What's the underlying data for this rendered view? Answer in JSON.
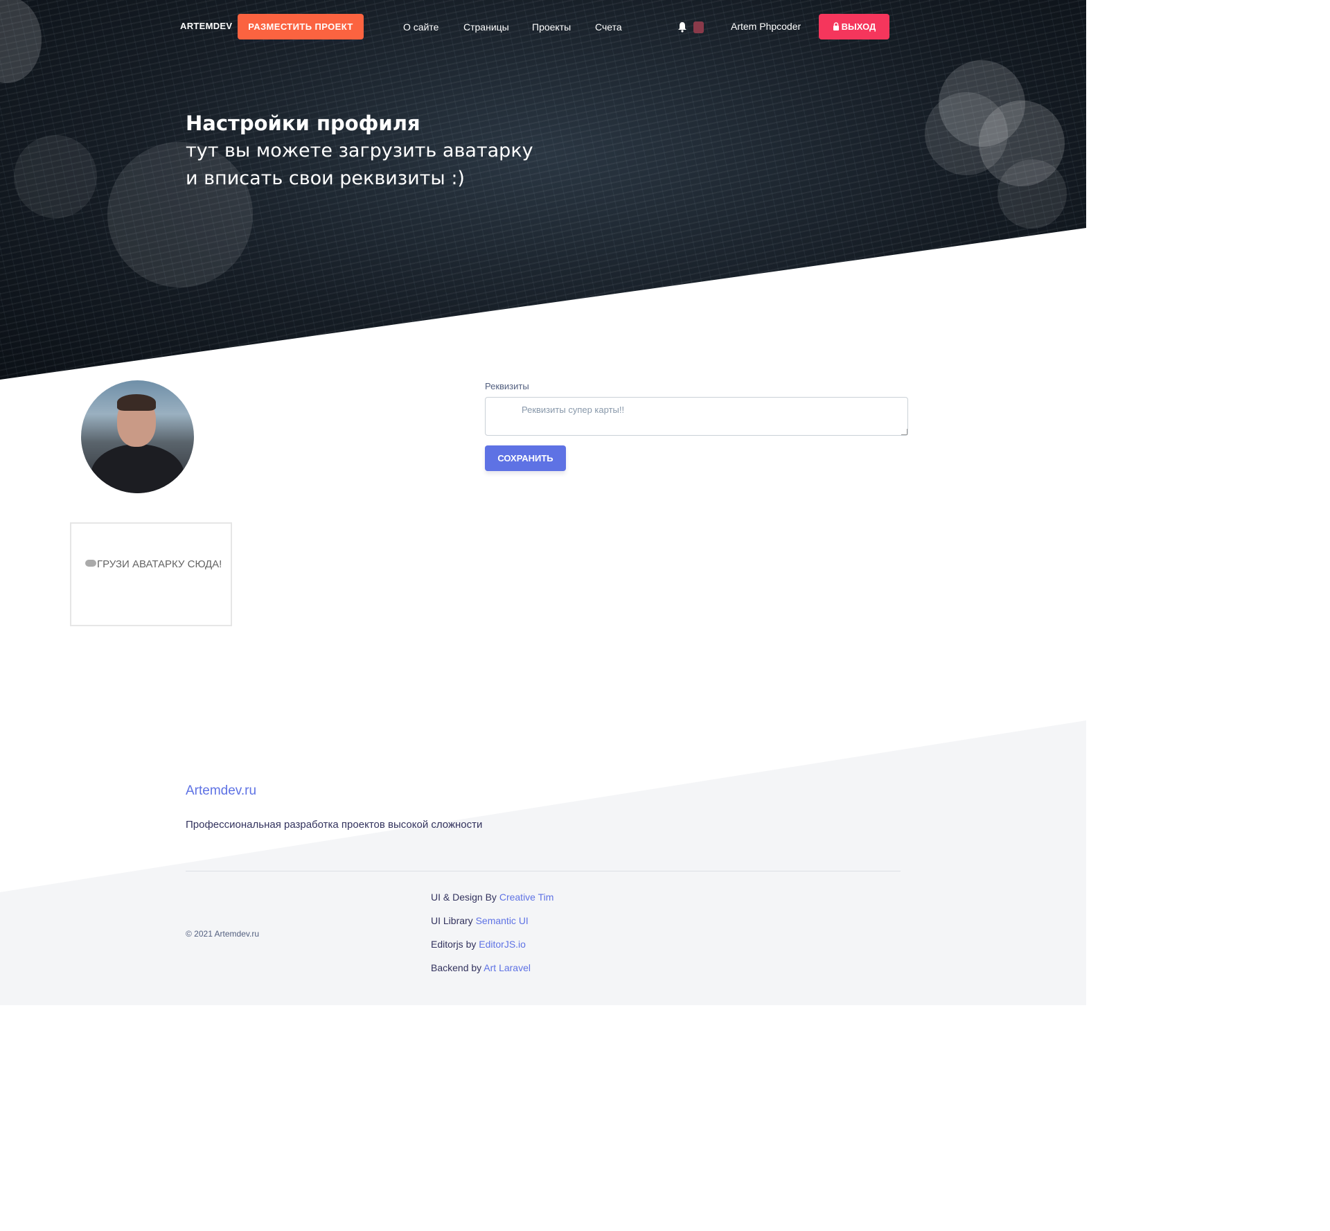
{
  "navbar": {
    "brand": "ARTEMDEV",
    "post_project_label": "РАЗМЕСТИТЬ ПРОЕКТ",
    "links": [
      "О сайте",
      "Страницы",
      "Проекты",
      "Счета"
    ],
    "username": "Artem Phpcoder",
    "logout_label": "ВЫХОД"
  },
  "hero": {
    "title": "Настройки профиля",
    "subtitle_line1": "тут вы можете загрузить аватарку",
    "subtitle_line2": "и вписать свои реквизиты :)"
  },
  "profile": {
    "dropzone_text": "ГРУЗИ АВАТАРКУ СЮДА!",
    "requisites_label": "Реквизиты",
    "requisites_value": "Реквизиты супер карты!!",
    "save_label": "СОХРАНИТЬ"
  },
  "footer": {
    "brand": "Artemdev.ru",
    "tagline": "Профессиональная разработка проектов высокой сложности",
    "copyright": "© 2021 Artemdev.ru",
    "credits": [
      {
        "prefix": "UI & Design By",
        "link": "Creative Tim"
      },
      {
        "prefix": "UI Library",
        "link": "Semantic UI"
      },
      {
        "prefix": "Editorjs by",
        "link": "EditorJS.io"
      },
      {
        "prefix": "Backend by",
        "link": "Art Laravel"
      }
    ]
  },
  "colors": {
    "accent_orange": "#fb6340",
    "accent_red": "#f5365c",
    "primary": "#5e72e4"
  }
}
